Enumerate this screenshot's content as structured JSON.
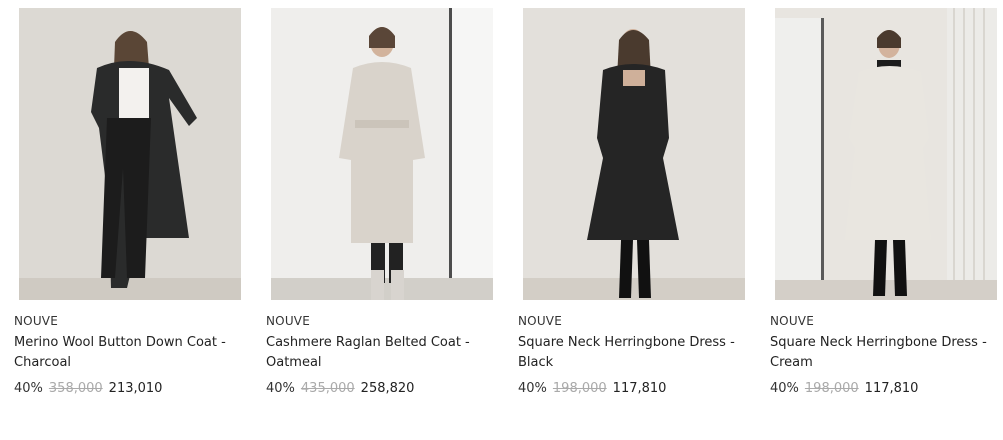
{
  "products": [
    {
      "brand": "NOUVE",
      "title": "Merino Wool Button Down Coat - Charcoal",
      "discount": "40%",
      "original_price": "358,000",
      "final_price": "213,010"
    },
    {
      "brand": "NOUVE",
      "title": "Cashmere Raglan Belted Coat - Oatmeal",
      "discount": "40%",
      "original_price": "435,000",
      "final_price": "258,820"
    },
    {
      "brand": "NOUVE",
      "title": "Square Neck Herringbone Dress - Black",
      "discount": "40%",
      "original_price": "198,000",
      "final_price": "117,810"
    },
    {
      "brand": "NOUVE",
      "title": "Square Neck Herringbone Dress - Cream",
      "discount": "40%",
      "original_price": "198,000",
      "final_price": "117,810"
    }
  ]
}
